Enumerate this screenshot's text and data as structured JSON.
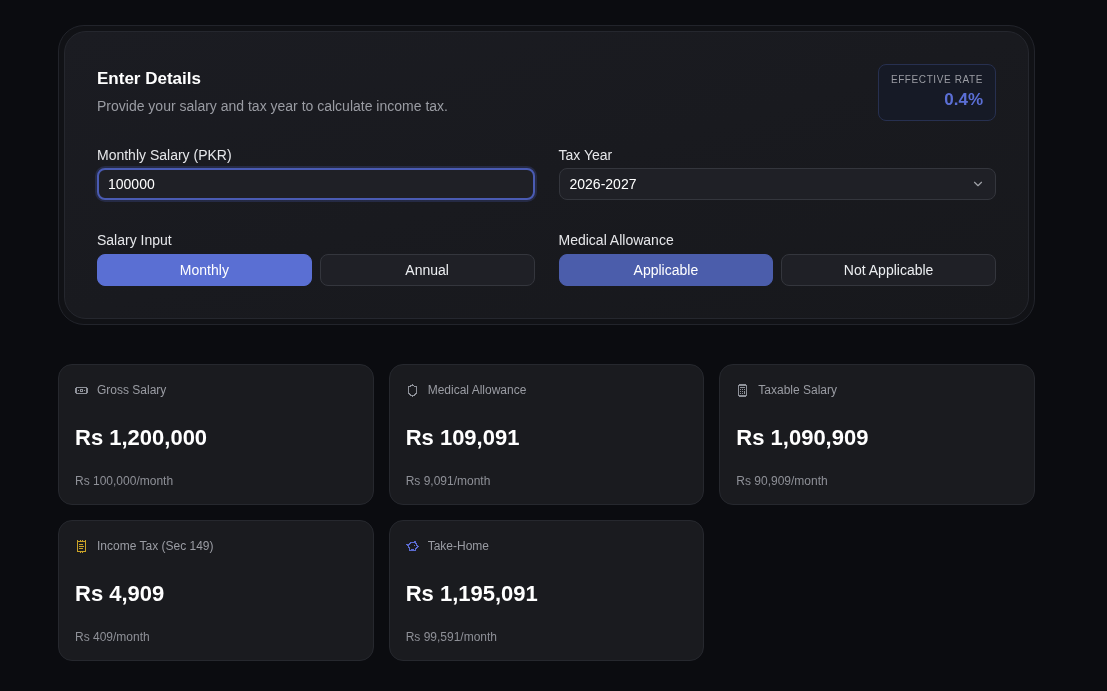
{
  "details": {
    "title": "Enter Details",
    "subtitle": "Provide your salary and tax year to calculate income tax.",
    "effective_rate": {
      "label": "EFFECTIVE RATE",
      "value": "0.4%"
    },
    "salary_field": {
      "label": "Monthly Salary (PKR)",
      "value": "100000"
    },
    "tax_year": {
      "label": "Tax Year",
      "value": "2026-2027"
    },
    "toggles": [
      {
        "label": "Salary Input",
        "options": [
          {
            "label": "Monthly",
            "selected": true
          },
          {
            "label": "Annual",
            "selected": false
          }
        ]
      },
      {
        "label": "Medical Allowance",
        "options": [
          {
            "label": "Applicable",
            "selected": true
          },
          {
            "label": "Not Applicable",
            "selected": false
          }
        ]
      }
    ]
  },
  "cards": [
    {
      "label": "Gross Salary",
      "value": "Rs 1,200,000",
      "monthly": "Rs 100,000/month",
      "color": "#8e9199"
    },
    {
      "label": "Medical Allowance",
      "value": "Rs 109,091",
      "monthly": "Rs 9,091/month",
      "color": "#8e9199"
    },
    {
      "label": "Taxable Salary",
      "value": "Rs 1,090,909",
      "monthly": "Rs 90,909/month",
      "color": "#8e9199"
    },
    {
      "label": "Income Tax (Sec 149)",
      "value": "Rs 4,909",
      "monthly": "Rs 409/month",
      "color": "#c9a227"
    },
    {
      "label": "Take-Home",
      "value": "Rs 1,195,091",
      "monthly": "Rs 99,591/month",
      "color": "#5b6bd0"
    }
  ]
}
